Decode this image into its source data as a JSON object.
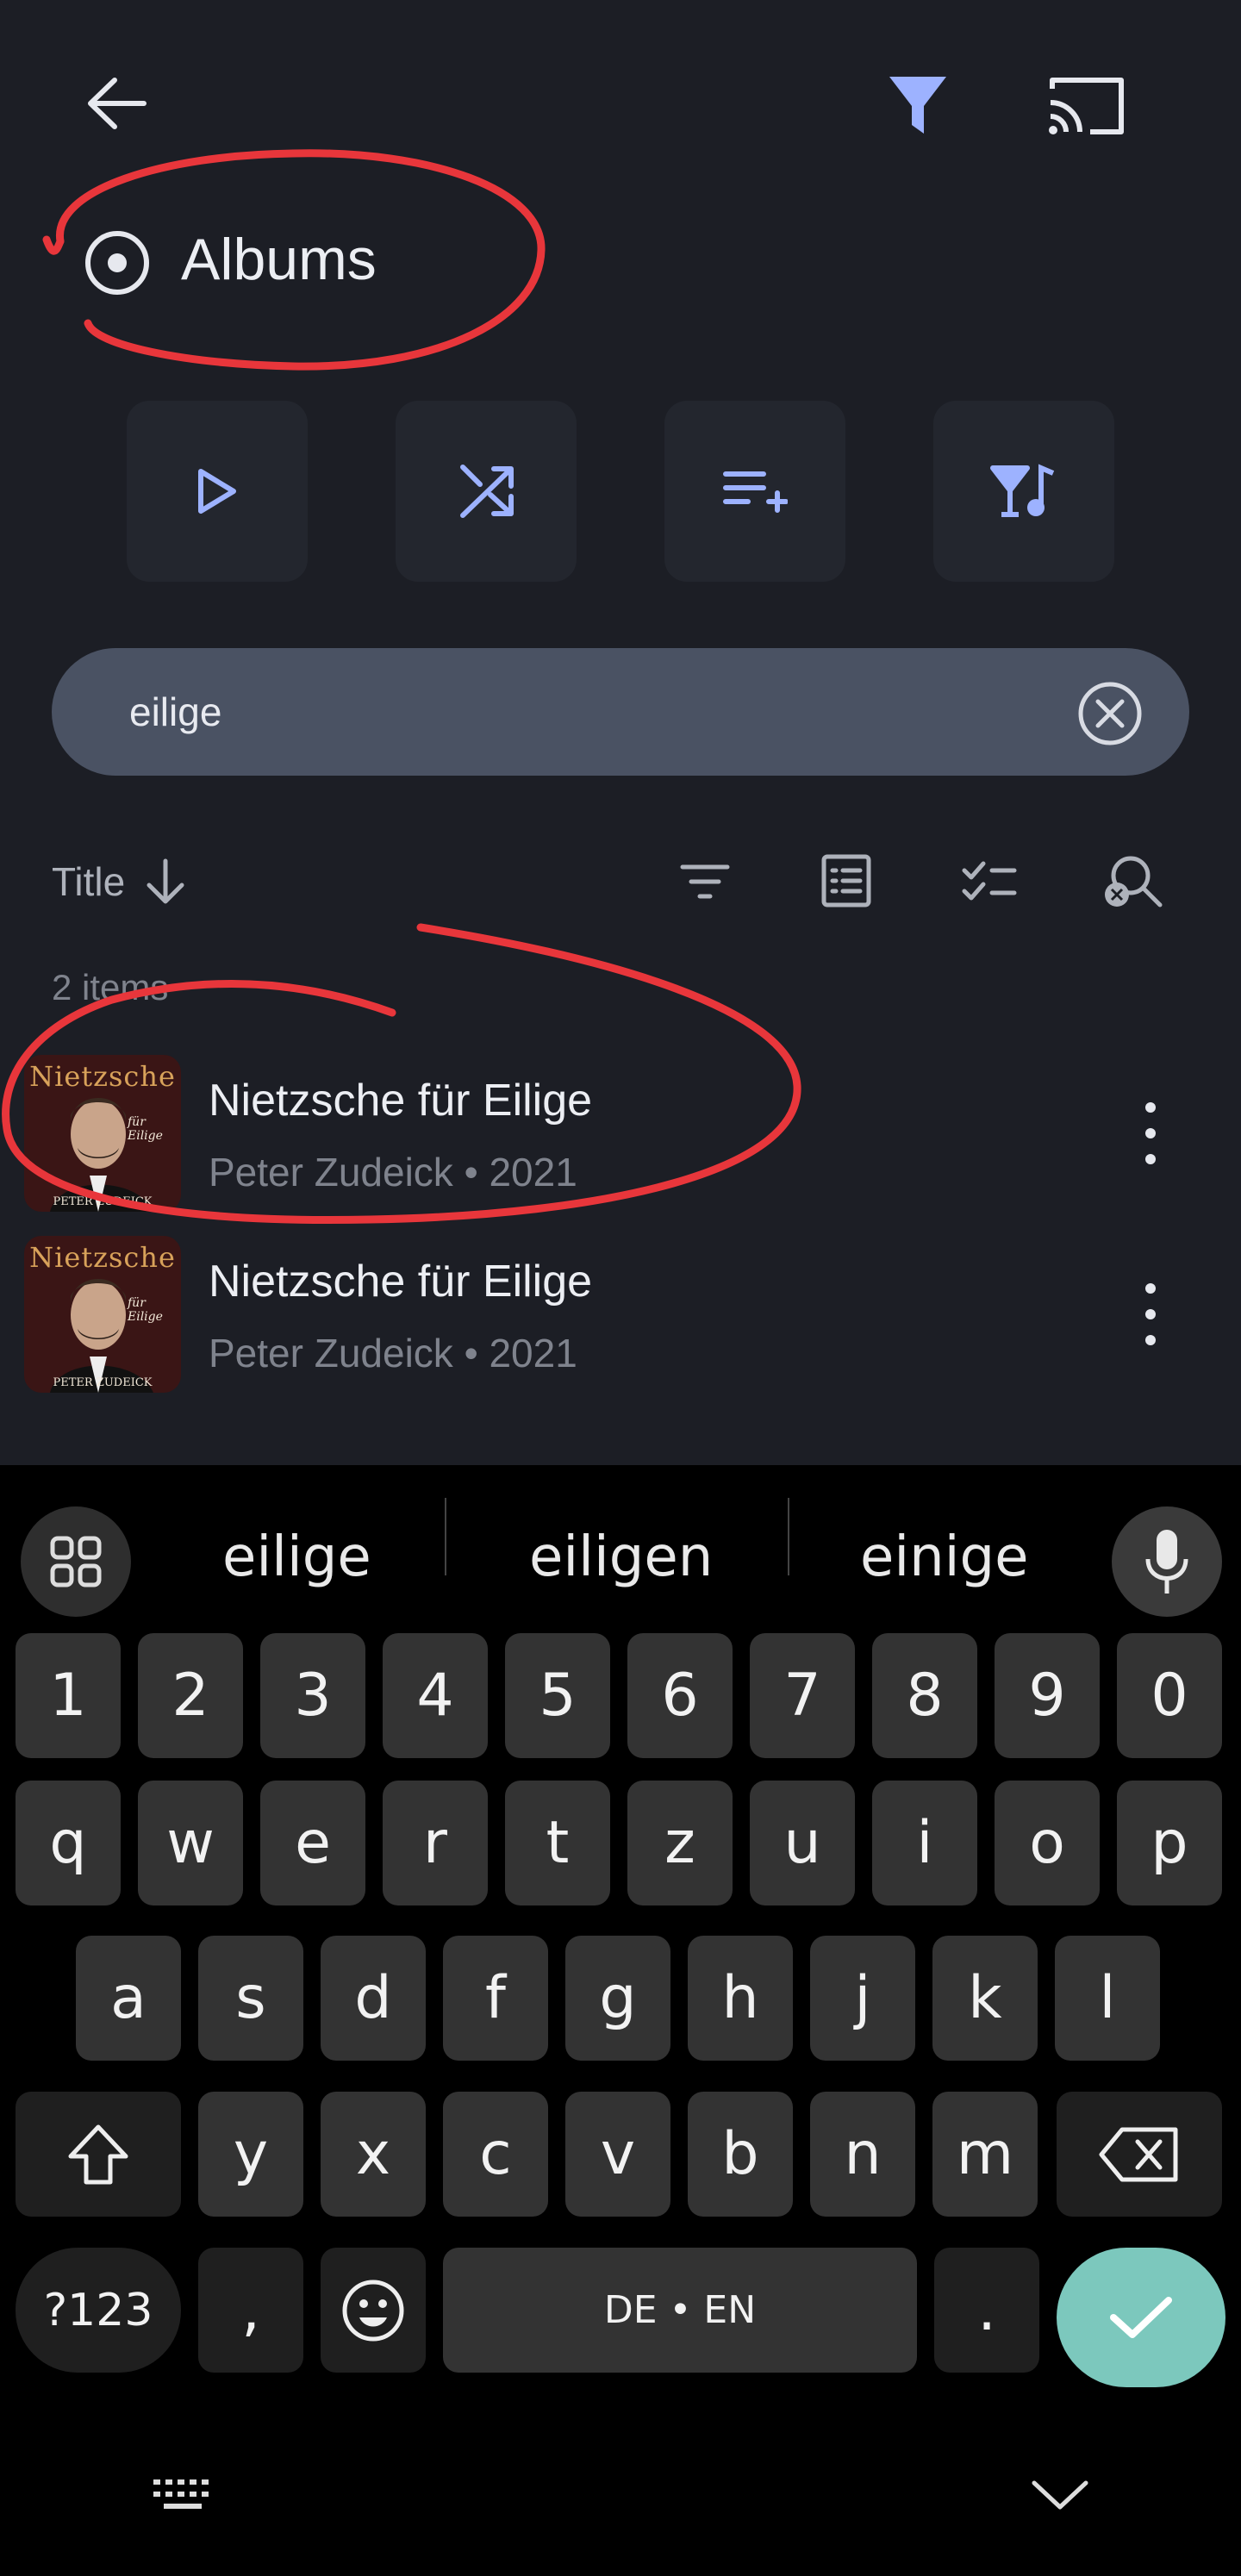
{
  "header": {
    "back_icon": "arrow-left-icon",
    "filter_icon": "filter-icon",
    "cast_icon": "cast-icon",
    "section_title": "Albums",
    "section_icon": "album-disc-icon"
  },
  "actions": [
    {
      "name": "play",
      "icon": "play-icon"
    },
    {
      "name": "shuffle",
      "icon": "shuffle-icon"
    },
    {
      "name": "add-to-queue",
      "icon": "playlist-add-icon"
    },
    {
      "name": "mix",
      "icon": "party-music-icon"
    }
  ],
  "search": {
    "value": "eilige",
    "placeholder": "",
    "clear_icon": "clear-circle-icon"
  },
  "sort": {
    "label": "Title",
    "direction_icon": "arrow-down-icon"
  },
  "toolbar_icons": [
    "filter-lines-icon",
    "list-view-icon",
    "select-list-icon",
    "search-clear-icon"
  ],
  "item_count": "2 items",
  "items": [
    {
      "title": "Nietzsche für Eilige",
      "subtitle": "Peter Zudeick • 2021",
      "cover_title": "Nietzsche",
      "cover_sub": "für Eilige",
      "cover_author": "PETER ZUDEICK"
    },
    {
      "title": "Nietzsche für Eilige",
      "subtitle": "Peter Zudeick • 2021",
      "cover_title": "Nietzsche",
      "cover_sub": "für Eilige",
      "cover_author": "PETER ZUDEICK"
    }
  ],
  "keyboard": {
    "suggestions": [
      "eilige",
      "eiligen",
      "einige"
    ],
    "numbers": [
      "1",
      "2",
      "3",
      "4",
      "5",
      "6",
      "7",
      "8",
      "9",
      "0"
    ],
    "row1": [
      "q",
      "w",
      "e",
      "r",
      "t",
      "z",
      "u",
      "i",
      "o",
      "p"
    ],
    "row2": [
      "a",
      "s",
      "d",
      "f",
      "g",
      "h",
      "j",
      "k",
      "l"
    ],
    "row3": [
      "y",
      "x",
      "c",
      "v",
      "b",
      "n",
      "m"
    ],
    "sym_label": "?123",
    "comma": ",",
    "space_label": "DE • EN",
    "period": ".",
    "colors": {
      "accent": "#7cc8bd",
      "annotation": "#e8363b",
      "icon_accent": "#9db2ff"
    }
  }
}
